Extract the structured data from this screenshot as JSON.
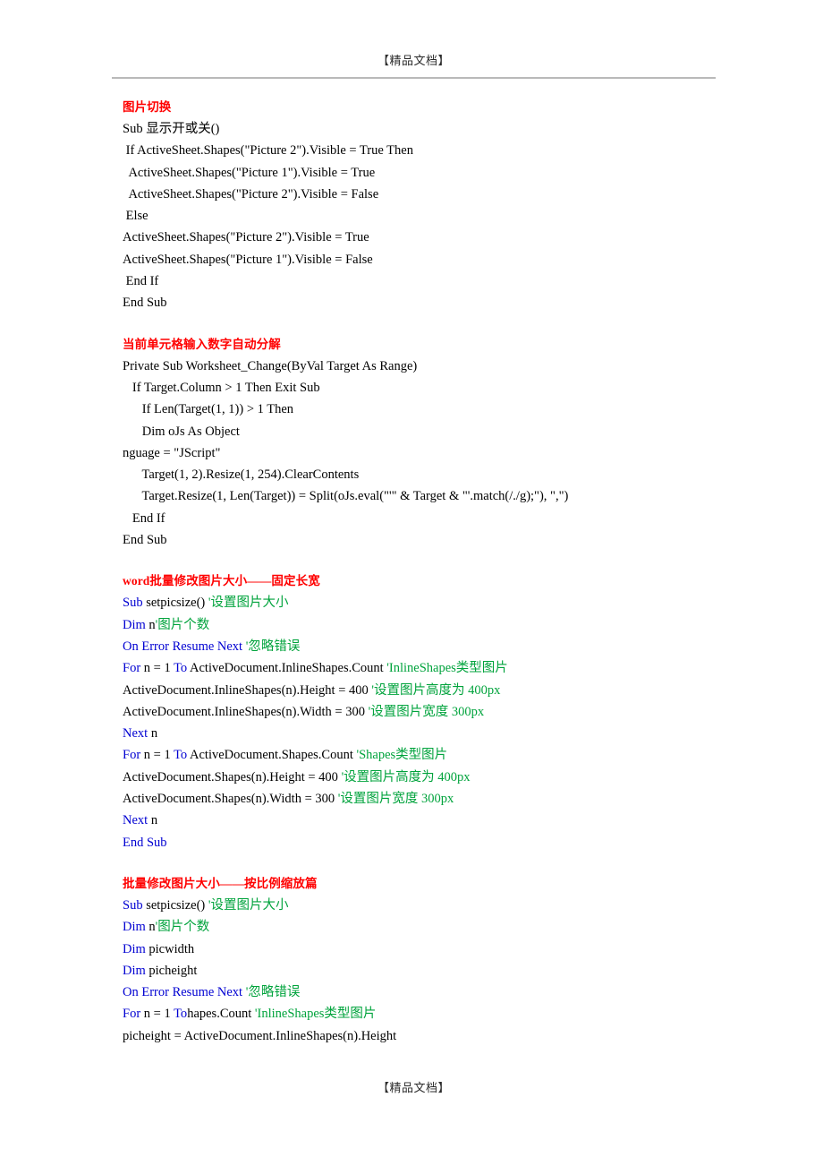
{
  "header": {
    "text": "【精品文档】"
  },
  "footer": {
    "text": "【精品文档】"
  },
  "colors": {
    "heading_red": "#ff0000",
    "keyword_blue": "#0000d2",
    "comment_green": "#00a33c",
    "body_black": "#000000",
    "rule_gray": "#b9b9b9"
  },
  "sections": [
    {
      "heading": "图片切换",
      "lines": [
        [
          {
            "t": "Sub 显示开或关()",
            "c": "plain"
          }
        ],
        [
          {
            "t": " If ActiveSheet.Shapes(\"Picture 2\").Visible = True Then",
            "c": "plain"
          }
        ],
        [
          {
            "t": "  ActiveSheet.Shapes(\"Picture 1\").Visible = True",
            "c": "plain"
          }
        ],
        [
          {
            "t": "  ActiveSheet.Shapes(\"Picture 2\").Visible = False",
            "c": "plain"
          }
        ],
        [
          {
            "t": " Else",
            "c": "plain"
          }
        ],
        [
          {
            "t": "ActiveSheet.Shapes(\"Picture 2\").Visible = True",
            "c": "plain"
          }
        ],
        [
          {
            "t": "ActiveSheet.Shapes(\"Picture 1\").Visible = False",
            "c": "plain"
          }
        ],
        [
          {
            "t": " End If",
            "c": "plain"
          }
        ],
        [
          {
            "t": "End Sub",
            "c": "plain"
          }
        ]
      ]
    },
    {
      "heading": "当前单元格输入数字自动分解",
      "lines": [
        [
          {
            "t": "Private Sub Worksheet_Change(ByVal Target As Range)",
            "c": "plain"
          }
        ],
        [
          {
            "t": "   If Target.Column > 1 Then Exit Sub",
            "c": "plain"
          }
        ],
        [
          {
            "t": "      If Len(Target(1, 1)) > 1 Then",
            "c": "plain"
          }
        ],
        [
          {
            "t": "      Dim oJs As Object",
            "c": "plain"
          }
        ],
        [
          {
            "t": "nguage = \"JScript\"",
            "c": "plain"
          }
        ],
        [
          {
            "t": "      Target(1, 2).Resize(1, 254).ClearContents",
            "c": "plain"
          }
        ],
        [
          {
            "t": "      Target.Resize(1, Len(Target)) = Split(oJs.eval(\"'\" & Target & \"'.match(/./g);\"), \",\")",
            "c": "plain"
          }
        ],
        [
          {
            "t": "   End If",
            "c": "plain"
          }
        ],
        [
          {
            "t": "End Sub",
            "c": "plain"
          }
        ]
      ]
    },
    {
      "heading": "word批量修改图片大小——固定长宽",
      "lines": [
        [
          {
            "t": "Sub",
            "c": "kw"
          },
          {
            "t": " setpicsize() ",
            "c": "plain"
          },
          {
            "t": "'设置图片大小",
            "c": "cmt"
          }
        ],
        [
          {
            "t": "Dim",
            "c": "kw"
          },
          {
            "t": " n",
            "c": "plain"
          },
          {
            "t": "'图片个数",
            "c": "cmt"
          }
        ],
        [
          {
            "t": "On Error Resume Next",
            "c": "kw"
          },
          {
            "t": " ",
            "c": "plain"
          },
          {
            "t": "'忽略错误",
            "c": "cmt"
          }
        ],
        [
          {
            "t": "For",
            "c": "kw"
          },
          {
            "t": " n = 1 ",
            "c": "plain"
          },
          {
            "t": "To",
            "c": "kw"
          },
          {
            "t": " ActiveDocument.InlineShapes.Count ",
            "c": "plain"
          },
          {
            "t": "'InlineShapes类型图片",
            "c": "cmt"
          }
        ],
        [
          {
            "t": "ActiveDocument.InlineShapes(n).Height = 400 ",
            "c": "plain"
          },
          {
            "t": "'设置图片高度为 400px",
            "c": "cmt"
          }
        ],
        [
          {
            "t": "ActiveDocument.InlineShapes(n).Width = 300 ",
            "c": "plain"
          },
          {
            "t": "'设置图片宽度 300px",
            "c": "cmt"
          }
        ],
        [
          {
            "t": "Next",
            "c": "kw"
          },
          {
            "t": " n",
            "c": "plain"
          }
        ],
        [
          {
            "t": "For",
            "c": "kw"
          },
          {
            "t": " n = 1 ",
            "c": "plain"
          },
          {
            "t": "To",
            "c": "kw"
          },
          {
            "t": " ActiveDocument.Shapes.Count ",
            "c": "plain"
          },
          {
            "t": "'Shapes类型图片",
            "c": "cmt"
          }
        ],
        [
          {
            "t": "ActiveDocument.Shapes(n).Height = 400 ",
            "c": "plain"
          },
          {
            "t": "'设置图片高度为 400px",
            "c": "cmt"
          }
        ],
        [
          {
            "t": "ActiveDocument.Shapes(n).Width = 300 ",
            "c": "plain"
          },
          {
            "t": "'设置图片宽度 300px",
            "c": "cmt"
          }
        ],
        [
          {
            "t": "Next",
            "c": "kw"
          },
          {
            "t": " n",
            "c": "plain"
          }
        ],
        [
          {
            "t": "End Sub",
            "c": "kw"
          }
        ]
      ]
    },
    {
      "heading": "批量修改图片大小——按比例缩放篇",
      "lines": [
        [
          {
            "t": "Sub",
            "c": "kw"
          },
          {
            "t": " setpicsize() ",
            "c": "plain"
          },
          {
            "t": "'设置图片大小",
            "c": "cmt"
          }
        ],
        [
          {
            "t": "Dim",
            "c": "kw"
          },
          {
            "t": " n",
            "c": "plain"
          },
          {
            "t": "'图片个数",
            "c": "cmt"
          }
        ],
        [
          {
            "t": "Dim",
            "c": "kw"
          },
          {
            "t": " picwidth",
            "c": "plain"
          }
        ],
        [
          {
            "t": "Dim",
            "c": "kw"
          },
          {
            "t": " picheight",
            "c": "plain"
          }
        ],
        [
          {
            "t": "On Error Resume Next",
            "c": "kw"
          },
          {
            "t": " ",
            "c": "plain"
          },
          {
            "t": "'忽略错误",
            "c": "cmt"
          }
        ],
        [
          {
            "t": "For",
            "c": "kw"
          },
          {
            "t": " n = 1 ",
            "c": "plain"
          },
          {
            "t": "To",
            "c": "kw"
          },
          {
            "t": "hapes.Count ",
            "c": "plain"
          },
          {
            "t": "'InlineShapes类型图片",
            "c": "cmt"
          }
        ],
        [
          {
            "t": "picheight = ActiveDocument.InlineShapes(n).Height",
            "c": "plain"
          }
        ]
      ]
    }
  ]
}
